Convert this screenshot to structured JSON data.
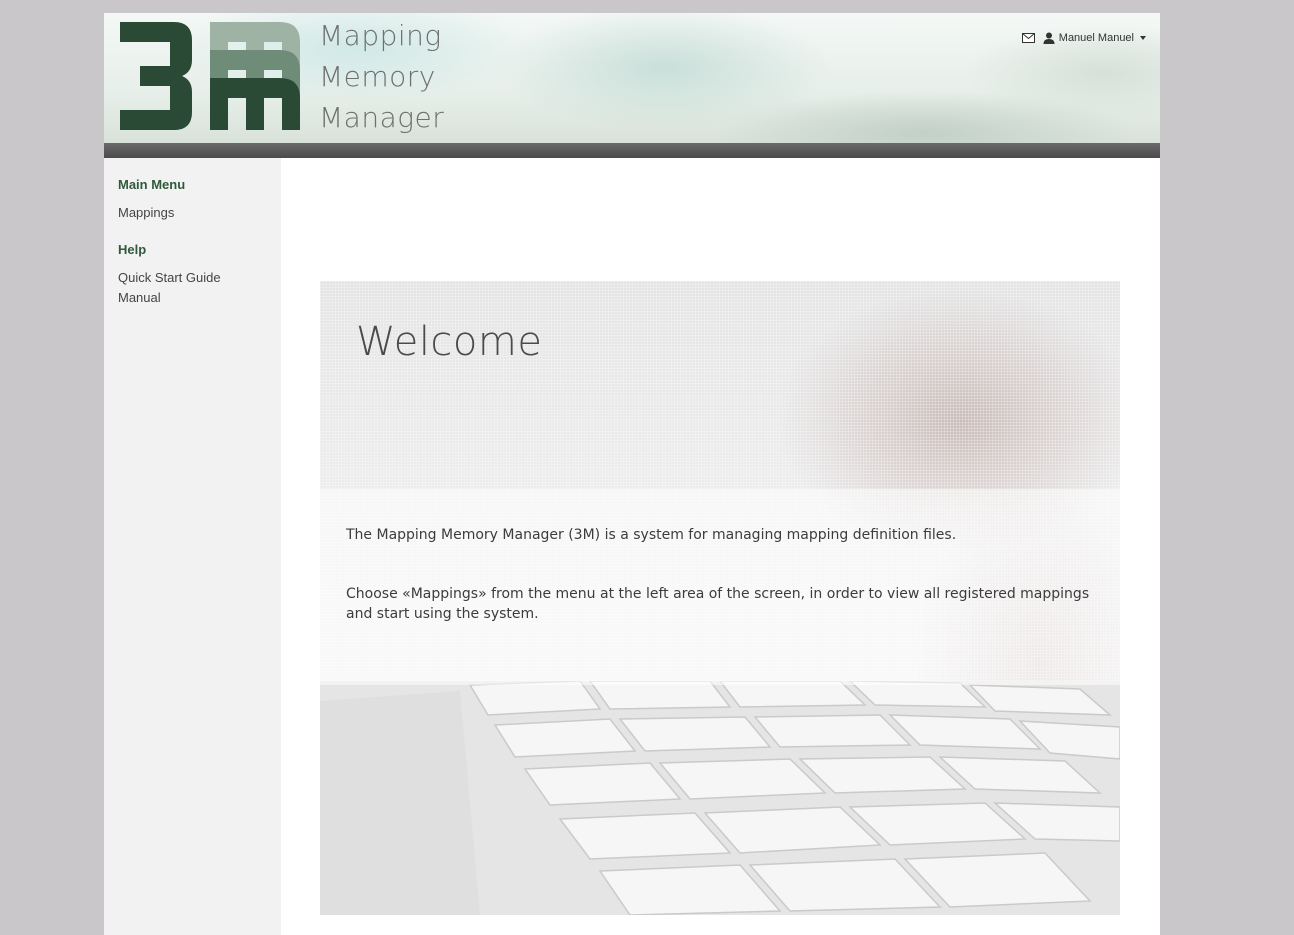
{
  "header": {
    "app_name_lines": [
      "Mapping",
      "Memory",
      "Manager"
    ],
    "user_name": "Manuel Manuel",
    "icons": [
      "mail-icon",
      "user-icon",
      "caret-down-icon"
    ]
  },
  "sidebar": {
    "main_menu": {
      "heading": "Main Menu",
      "items": [
        {
          "label": "Mappings"
        }
      ]
    },
    "help": {
      "heading": "Help",
      "items": [
        {
          "label": "Quick Start Guide"
        },
        {
          "label": "Manual"
        }
      ]
    }
  },
  "welcome": {
    "title": "Welcome",
    "paragraph_1": "The Mapping Memory Manager (3M) is a system for managing mapping definition files.",
    "paragraph_2": "Choose «Mappings» from the menu at the left area of the screen, in order to view all registered mappings and start using the system."
  },
  "colors": {
    "accent_green": "#2f5a3a",
    "logo_dark": "#2b4a36",
    "logo_light": "#8fa596",
    "header_bar": "#4b4b4b",
    "background": "#c9c7c9"
  }
}
